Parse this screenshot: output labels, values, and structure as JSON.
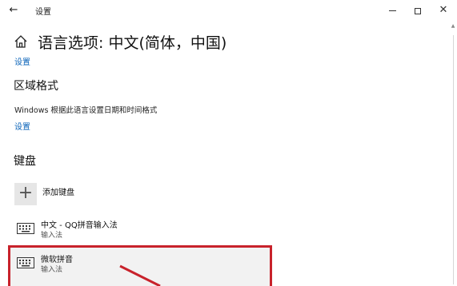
{
  "window": {
    "app_title": "设置",
    "back_icon": "back-arrow-icon",
    "minimize_icon": "minimize-icon",
    "maximize_icon": "maximize-icon",
    "close_icon": "close-icon"
  },
  "header": {
    "home_icon": "home-icon",
    "title": "语言选项: 中文(简体，中国)",
    "settings_link": "设置"
  },
  "region_format": {
    "heading": "区域格式",
    "description": "Windows 根据此语言设置日期和时间格式",
    "settings_link": "设置"
  },
  "keyboard": {
    "heading": "键盘",
    "add_label": "添加键盘",
    "add_icon": "plus-icon",
    "items": [
      {
        "name": "中文 - QQ拼音输入法",
        "type": "输入法",
        "icon": "keyboard-icon"
      },
      {
        "name": "微软拼音",
        "type": "输入法",
        "icon": "keyboard-icon",
        "highlighted": true
      }
    ]
  },
  "colors": {
    "link": "#0a63b8",
    "highlight_border": "#c8222b",
    "selected_bg": "#f2f2f2"
  }
}
